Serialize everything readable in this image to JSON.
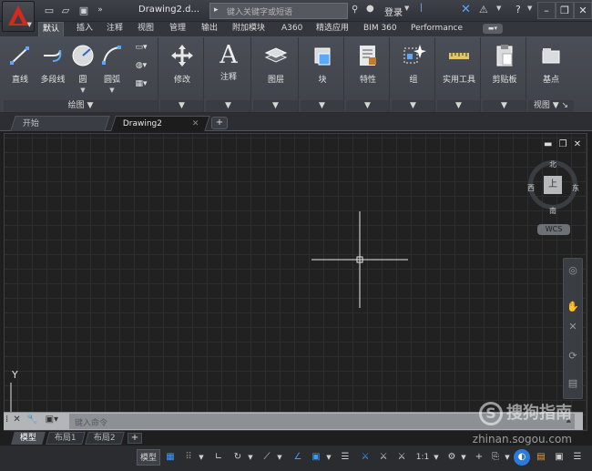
{
  "app": {
    "doc_title": "Drawing2.d...",
    "search_placeholder": "键入关键字或短语",
    "login_label": "登录",
    "help_label": "?"
  },
  "colors": {
    "accent_red": "#d42a1e",
    "canvas_bg": "#212121",
    "status_blue": "#3c9aff"
  },
  "ribbon_tabs": [
    {
      "label": "默认",
      "active": true
    },
    {
      "label": "插入"
    },
    {
      "label": "注释"
    },
    {
      "label": "视图"
    },
    {
      "label": "管理"
    },
    {
      "label": "输出"
    },
    {
      "label": "附加模块"
    },
    {
      "label": "A360"
    },
    {
      "label": "精选应用"
    },
    {
      "label": "BIM 360"
    },
    {
      "label": "Performance"
    }
  ],
  "ribbon": {
    "draw": {
      "title": "绘图",
      "line": "直线",
      "polyline": "多段线",
      "circle": "圆",
      "arc": "圆弧"
    },
    "modify": "修改",
    "annotate": "注释",
    "layers": "图层",
    "block": "块",
    "properties": "特性",
    "groups": "组",
    "utilities": "实用工具",
    "clipboard": "剪贴板",
    "view": {
      "base": "基点",
      "title": "视图"
    }
  },
  "file_tabs": [
    {
      "label": "开始"
    },
    {
      "label": "Drawing2",
      "active": true
    }
  ],
  "viewcube": {
    "top_face": "上",
    "north": "北",
    "south": "南",
    "east": "东",
    "west": "西",
    "wcs": "WCS"
  },
  "ucs": {
    "y_label": "Y"
  },
  "command": {
    "placeholder": "键入命令"
  },
  "layout_tabs": [
    {
      "label": "模型",
      "active": true
    },
    {
      "label": "布局1"
    },
    {
      "label": "布局2"
    }
  ],
  "status": {
    "model": "模型",
    "scale": "1:1"
  },
  "watermark": {
    "brand": "搜狗指南",
    "url": "zhinan.sogou.com"
  }
}
